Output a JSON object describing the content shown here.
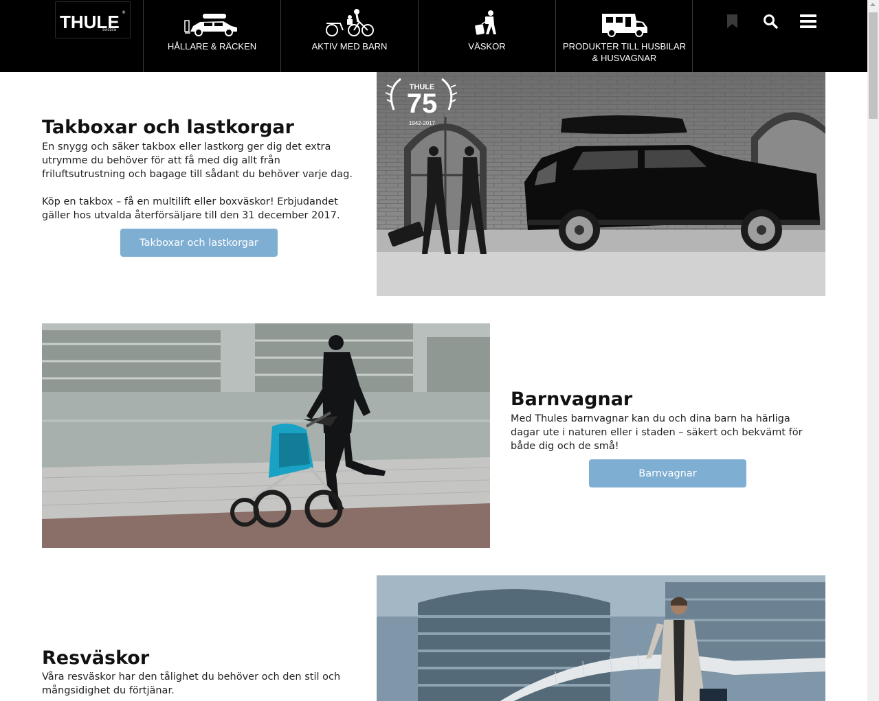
{
  "header": {
    "logo_text": "THULE",
    "logo_sub": "SWEDEN",
    "nav": [
      {
        "label": "HÅLLARE & RÄCKEN",
        "icon": "car-roof-rack-icon"
      },
      {
        "label": "AKTIV MED BARN",
        "icon": "bike-child-trailer-icon"
      },
      {
        "label": "VÄSKOR",
        "icon": "hiker-luggage-icon"
      },
      {
        "label": "PRODUKTER TILL HUSBILAR & HUSVAGNAR",
        "icon": "motorhome-icon"
      }
    ],
    "utilities": [
      "bookmark-icon",
      "search-icon",
      "hamburger-menu-icon"
    ]
  },
  "sections": [
    {
      "title": "Takboxar och lastkorgar",
      "paragraphs": [
        "En snygg och säker takbox eller lastkorg ger dig det extra utrymme du behöver för att få med dig allt från friluftsutrustning och bagage till sådant du behöver varje dag.",
        "Köp en takbox – få en multilift eller boxväskor! Erbjudandet gäller hos utvalda återförsäljare till den 31 december 2017."
      ],
      "button": "Takboxar och lastkorgar",
      "badge_number": "75",
      "badge_years": "1942-2017",
      "badge_brand": "THULE"
    },
    {
      "title": "Barnvagnar",
      "paragraphs": [
        "Med Thules barnvagnar kan du och dina barn ha härliga dagar ute i naturen eller i staden – säkert och bekvämt för både dig och de små!"
      ],
      "button": "Barnvagnar"
    },
    {
      "title": "Resväskor",
      "paragraphs": [
        "Våra resväskor har den tålighet du behöver och den stil och mångsidighet du förtjänar."
      ]
    }
  ],
  "colors": {
    "nav_bg": "#000000",
    "button_bg": "#7eaed2"
  }
}
